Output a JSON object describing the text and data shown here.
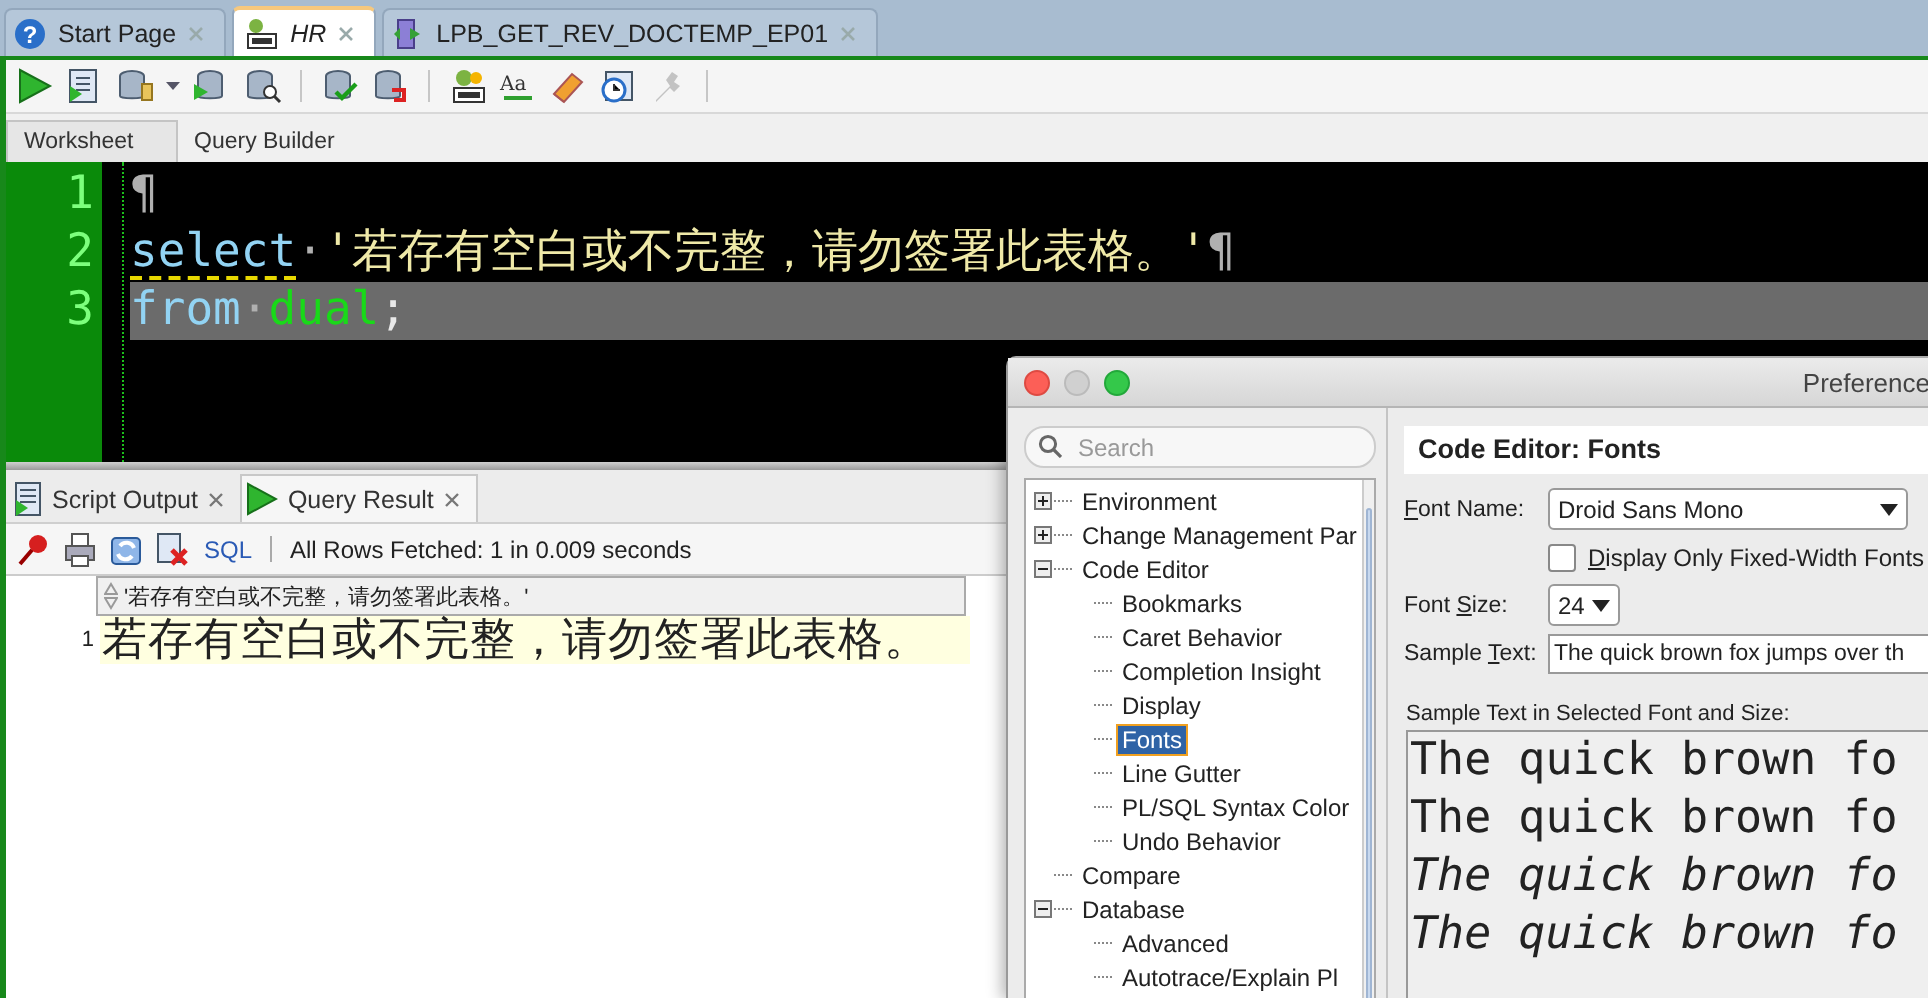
{
  "document_tabs": [
    {
      "label": "Start Page",
      "kind": "help",
      "glyph": "?",
      "selected": false
    },
    {
      "label": "HR",
      "kind": "sql",
      "selected": true
    },
    {
      "label": "LPB_GET_REV_DOCTEMP_EP01",
      "kind": "procedure",
      "selected": false
    }
  ],
  "toolbar": {
    "groups": [
      [
        {
          "kind": "run",
          "disabled": false
        },
        {
          "kind": "script",
          "disabled": false
        },
        {
          "kind": "database",
          "disabled": false
        },
        {
          "kind": "caret",
          "disabled": false
        },
        {
          "kind": "database-run",
          "disabled": false
        },
        {
          "kind": "database-search",
          "disabled": false
        }
      ],
      [
        {
          "kind": "database-check",
          "disabled": false
        },
        {
          "kind": "database-undo",
          "disabled": false
        }
      ],
      [
        {
          "kind": "sql",
          "disabled": false
        },
        {
          "kind": "text-case",
          "glyph": "Aa",
          "disabled": false
        },
        {
          "kind": "eraser",
          "disabled": false
        },
        {
          "kind": "clock",
          "disabled": false
        },
        {
          "kind": "tool",
          "disabled": true
        }
      ]
    ]
  },
  "editor_tabs": [
    {
      "label": "Worksheet",
      "selected": true
    },
    {
      "label": "Query Builder",
      "selected": false
    }
  ],
  "editor": {
    "lines": [
      {
        "number": "1",
        "highlighted": false,
        "tokens": [
          {
            "kind": "mark",
            "text": "¶"
          }
        ]
      },
      {
        "number": "2",
        "highlighted": false,
        "tokens": [
          {
            "kind": "keyword",
            "text": "select",
            "underline": true
          },
          {
            "kind": "mark",
            "text": "·"
          },
          {
            "kind": "string",
            "text": "'若存有空白或不完整，请勿签署此表格。'"
          },
          {
            "kind": "mark",
            "text": "¶"
          }
        ]
      },
      {
        "number": "3",
        "highlighted": true,
        "tokens": [
          {
            "kind": "keyword",
            "text": "from",
            "underline": false
          },
          {
            "kind": "mark",
            "text": "·"
          },
          {
            "kind": "identifier",
            "text": "dual"
          },
          {
            "kind": "punct",
            "text": ";"
          }
        ]
      }
    ]
  },
  "result_tabs": [
    {
      "label": "Script Output",
      "kind": "script",
      "selected": false
    },
    {
      "label": "Query Result",
      "kind": "run",
      "selected": true
    }
  ],
  "result_toolbar": {
    "icons": [
      {
        "kind": "pin"
      },
      {
        "kind": "print"
      },
      {
        "kind": "refresh"
      },
      {
        "kind": "delete"
      }
    ],
    "sql_link": "SQL",
    "status": "All Rows Fetched: 1 in 0.009 seconds"
  },
  "grid": {
    "columns": [
      "'若存有空白或不完整，请勿签署此表格。'"
    ],
    "rows": [
      {
        "number": "1",
        "cells": [
          "若存有空白或不完整，请勿签署此表格。"
        ]
      }
    ]
  },
  "preferences": {
    "title": "Preference",
    "search": {
      "placeholder": "Search"
    },
    "tree": [
      {
        "label": "Environment",
        "expanded": false,
        "selected": false
      },
      {
        "label": "Change Management Par",
        "expanded": false,
        "selected": false
      },
      {
        "label": "Code Editor",
        "expanded": true,
        "selected": false,
        "children": [
          {
            "label": "Bookmarks",
            "selected": false
          },
          {
            "label": "Caret Behavior",
            "selected": false
          },
          {
            "label": "Completion Insight",
            "selected": false
          },
          {
            "label": "Display",
            "selected": false
          },
          {
            "label": "Fonts",
            "selected": true
          },
          {
            "label": "Line Gutter",
            "selected": false
          },
          {
            "label": "PL/SQL Syntax Color",
            "selected": false
          },
          {
            "label": "Undo Behavior",
            "selected": false
          }
        ]
      },
      {
        "label": "Compare",
        "selected": false
      },
      {
        "label": "Database",
        "expanded": true,
        "selected": false,
        "children": [
          {
            "label": "Advanced",
            "selected": false
          },
          {
            "label": "Autotrace/Explain Pl",
            "selected": false
          }
        ]
      }
    ],
    "heading": "Code Editor: Fonts",
    "font_name": {
      "label": "Font Name:",
      "value": "Droid Sans Mono"
    },
    "fixed_width": {
      "label": "Display Only Fixed-Width Fonts",
      "checked": false
    },
    "font_size": {
      "label": "Font Size:",
      "value": "24"
    },
    "sample_text": {
      "label": "Sample Text:",
      "value": "The quick brown fox jumps over th"
    },
    "preview": {
      "label": "Sample Text in Selected Font and Size:",
      "lines": [
        "The quick brown fo",
        "The quick brown fo",
        "The quick brown fo",
        "The quick brown fo"
      ]
    }
  }
}
